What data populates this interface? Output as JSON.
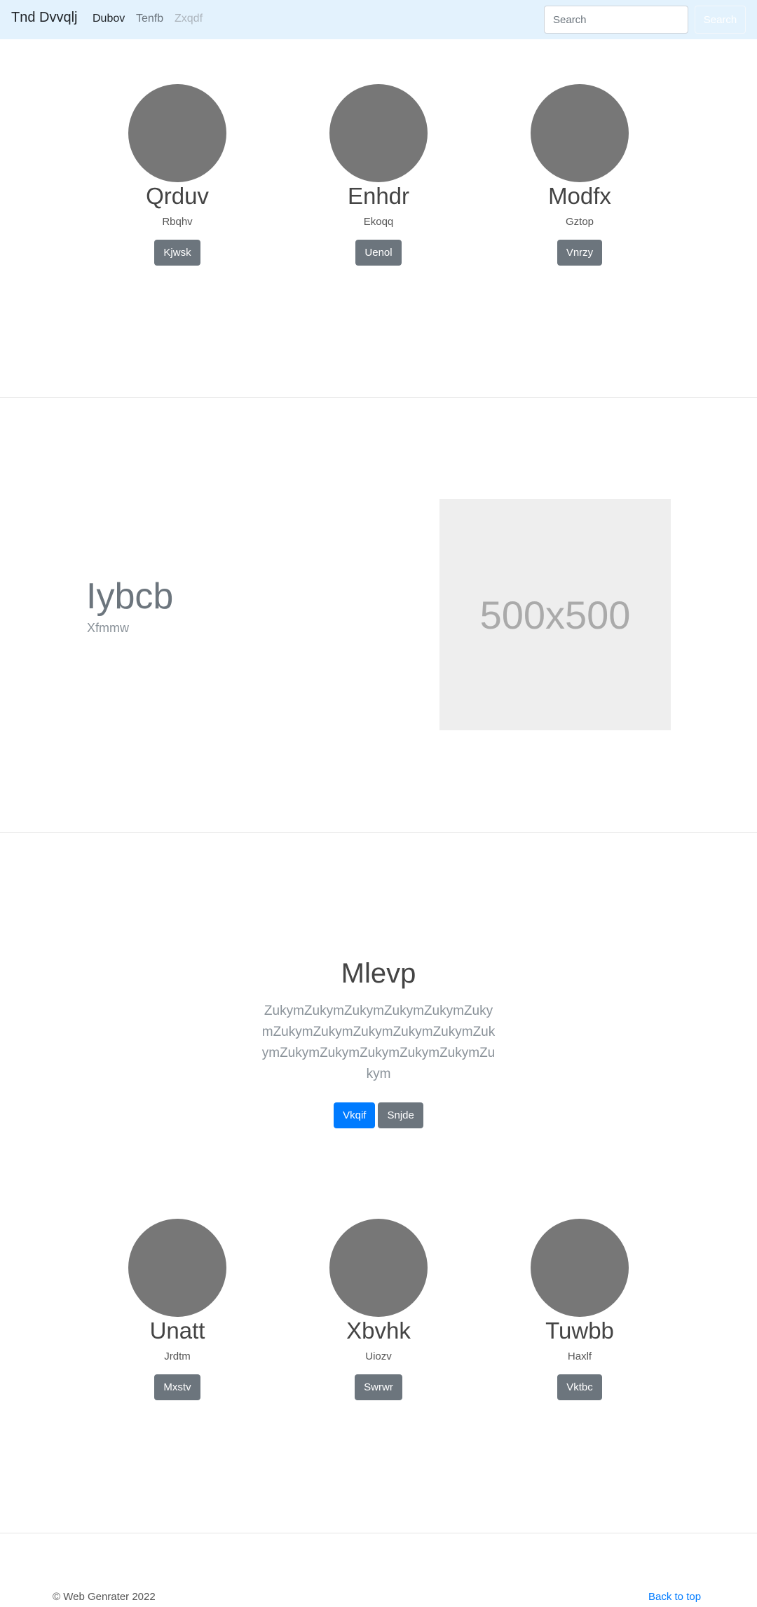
{
  "navbar": {
    "brand": "Tnd Dvvqlj",
    "links": [
      {
        "label": "Dubov",
        "state": "active"
      },
      {
        "label": "Tenfb",
        "state": "normal"
      },
      {
        "label": "Zxqdf",
        "state": "disabled"
      }
    ],
    "search_placeholder": "Search",
    "search_button": "Search"
  },
  "profiles_top": [
    {
      "name": "Qrduv",
      "role": "Rbqhv",
      "button": "Kjwsk"
    },
    {
      "name": "Enhdr",
      "role": "Ekoqq",
      "button": "Uenol"
    },
    {
      "name": "Modfx",
      "role": "Gztop",
      "button": "Vnrzy"
    }
  ],
  "hero": {
    "title": "Iybcb",
    "subtitle": "Xfmmw",
    "image_label": "500x500"
  },
  "jumbotron": {
    "title": "Mlevp",
    "text": "ZukymZukymZukymZukymZukymZukymZukymZukymZukymZukymZukymZukymZukymZukymZukymZukymZukymZukym",
    "primary_button": "Vkqif",
    "secondary_button": "Snjde"
  },
  "profiles_bottom": [
    {
      "name": "Unatt",
      "role": "Jrdtm",
      "button": "Mxstv"
    },
    {
      "name": "Xbvhk",
      "role": "Uiozv",
      "button": "Swrwr"
    },
    {
      "name": "Tuwbb",
      "role": "Haxlf",
      "button": "Vktbc"
    }
  ],
  "footer": {
    "copyright": "© Web Genrater 2022",
    "back_to_top": "Back to top"
  },
  "colors": {
    "navbar_bg": "#e3f2fd",
    "avatar": "#777777",
    "secondary_button": "#6c757d",
    "primary_button": "#007bff",
    "placeholder_bg": "#eeeeee"
  }
}
